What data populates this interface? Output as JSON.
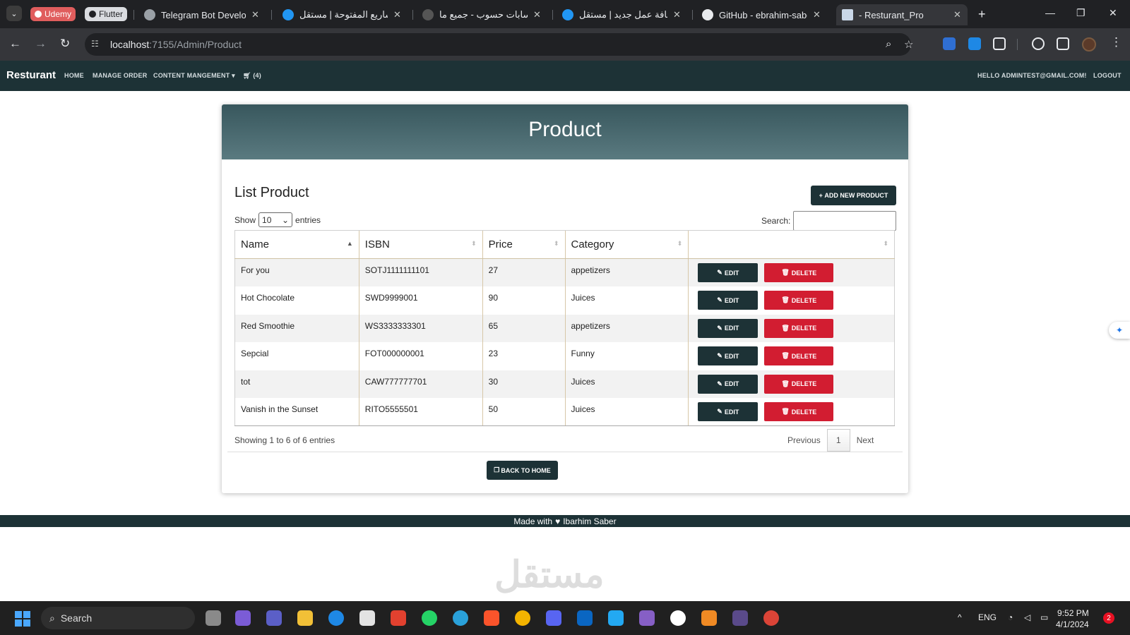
{
  "browser": {
    "pinned": [
      {
        "label": "Udemy",
        "color": "#e05d5d"
      },
      {
        "label": "Flutter",
        "color": "#dadce0"
      }
    ],
    "tabs": [
      {
        "title": "Telegram Bot Developm",
        "icon": "chatgpt-icon"
      },
      {
        "title": "المشاريع المفتوحة | مستقل",
        "icon": "mostaql-icon"
      },
      {
        "title": "حسابات حسوب - جميع ما",
        "icon": "hsoub-icon"
      },
      {
        "title": "إضافة عمل جديد | مستقل",
        "icon": "mostaql-icon"
      },
      {
        "title": "GitHub - ebrahim-saber",
        "icon": "github-icon"
      },
      {
        "title": "- Resturant_Pro",
        "icon": "page-icon",
        "active": true
      }
    ],
    "url_host": "localhost",
    "url_path": ":7155/Admin/Product"
  },
  "site": {
    "brand": "Resturant",
    "nav": {
      "home": "HOME",
      "manage_order": "MANAGE ORDER",
      "content": "CONTENT MANGEMENT",
      "cart_count": "(4)",
      "hello": "HELLO ADMINTEST@GMAIL.COM!",
      "logout": "LOGOUT"
    }
  },
  "page": {
    "header_title": "Product",
    "list_title": "List Product",
    "add_button": "ADD NEW PRODUCT",
    "show_label": "Show",
    "page_size": "10",
    "entries_label": "entries",
    "search_label": "Search:",
    "columns": [
      "Name",
      "ISBN",
      "Price",
      "Category"
    ],
    "rows": [
      {
        "name": "For you",
        "isbn": "SOTJ1111111101",
        "price": "27",
        "category": "appetizers"
      },
      {
        "name": "Hot Chocolate",
        "isbn": "SWD9999001",
        "price": "90",
        "category": "Juices"
      },
      {
        "name": "Red Smoothie",
        "isbn": "WS3333333301",
        "price": "65",
        "category": "appetizers"
      },
      {
        "name": "Sepcial",
        "isbn": "FOT000000001",
        "price": "23",
        "category": "Funny"
      },
      {
        "name": "tot",
        "isbn": "CAW777777701",
        "price": "30",
        "category": "Juices"
      },
      {
        "name": "Vanish in the Sunset",
        "isbn": "RITO5555501",
        "price": "50",
        "category": "Juices"
      }
    ],
    "edit_label": "EDIT",
    "delete_label": "DELETE",
    "showing": "Showing 1 to 6 of 6 entries",
    "pager": {
      "previous": "Previous",
      "current": "1",
      "next": "Next"
    },
    "back_button": "BACK TO HOME",
    "footer_prefix": "Made with",
    "footer_author": "Ibarhim Saber"
  },
  "watermark": "مستقل",
  "taskbar": {
    "search": "Search",
    "lang": "ENG",
    "time": "9:52 PM",
    "date": "4/1/2024",
    "notifications": "2"
  },
  "colors": {
    "navbar": "#1d3236",
    "delete": "#d21d31",
    "header_gradient_top": "#38575d"
  }
}
